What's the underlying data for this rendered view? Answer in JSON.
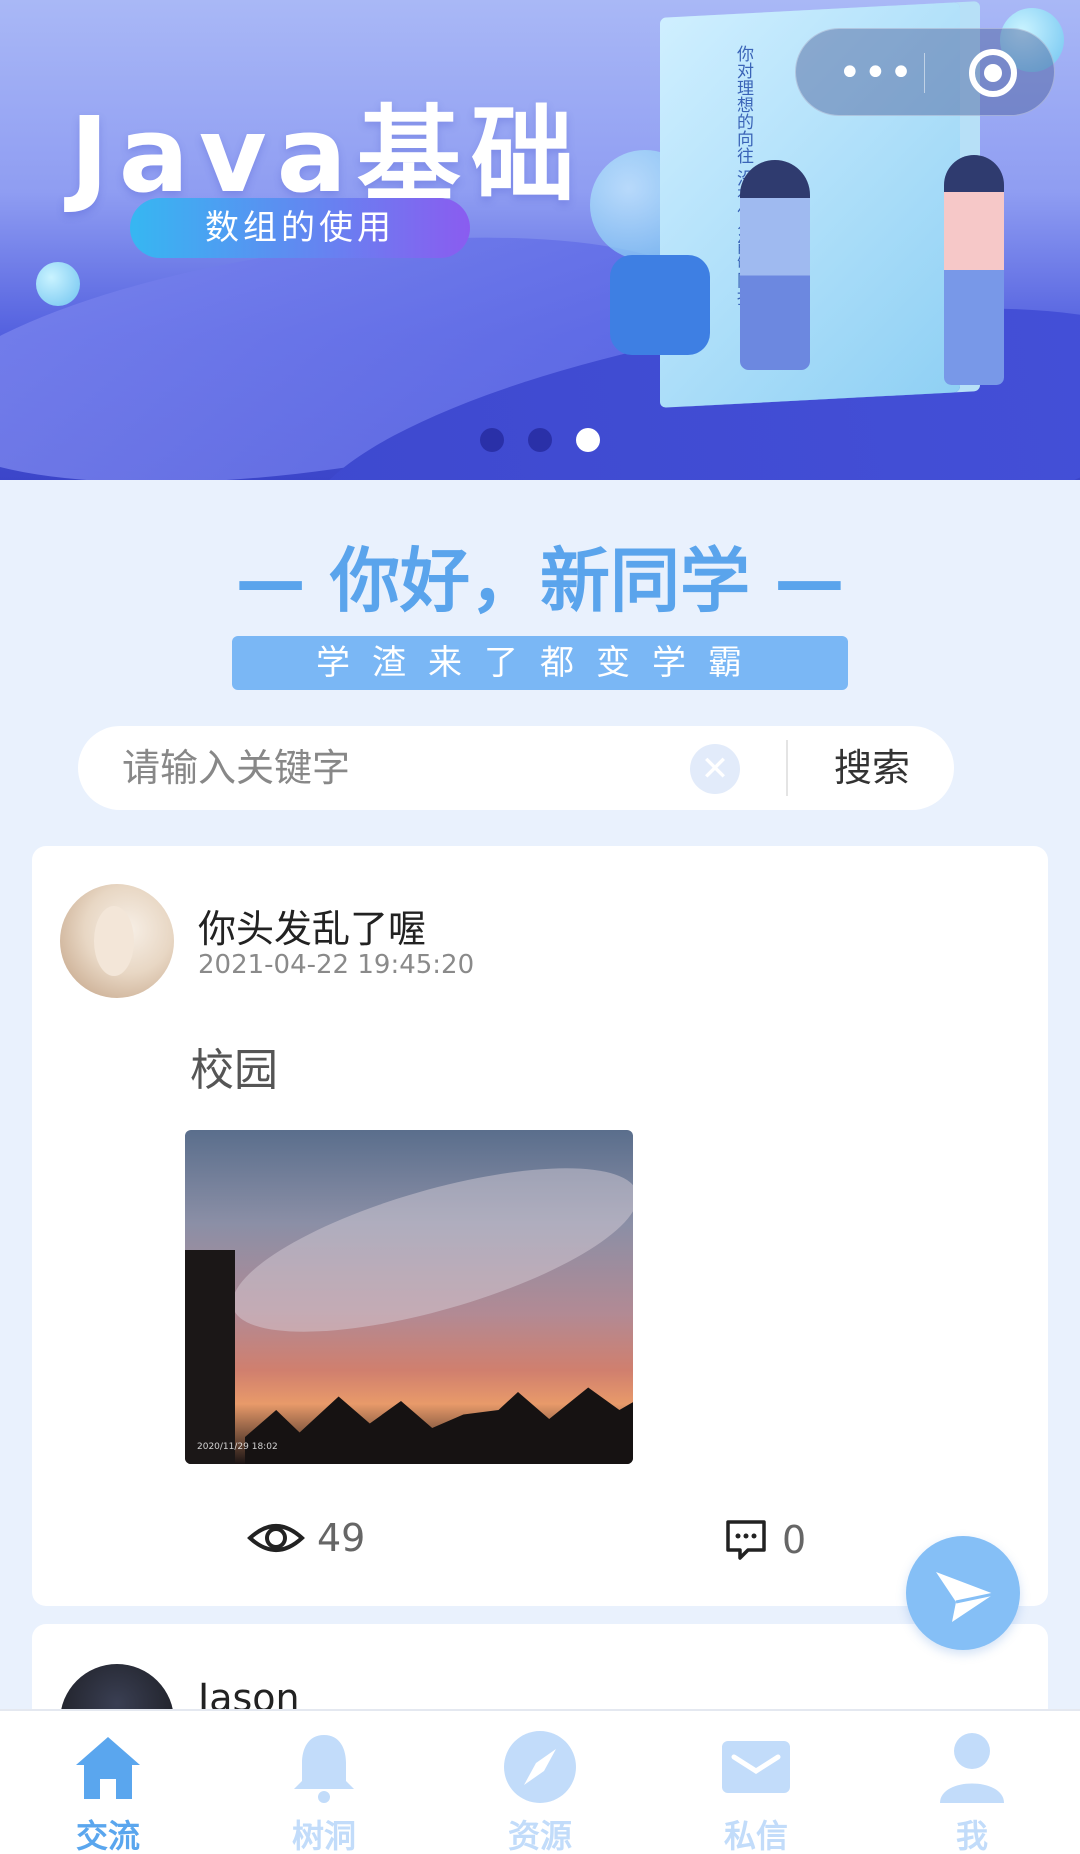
{
  "banner": {
    "title": "Java基础",
    "subtitle": "数组的使用",
    "book_text": "你对理想的向往 没有什么能够阻挡",
    "indicator_count": 3,
    "active_indicator": 3
  },
  "capsule": {
    "more_icon": "more-dots-icon",
    "close_icon": "target-icon"
  },
  "greeting": "— 你好，新同学 —",
  "slogan": "学渣来了都变学霸",
  "search": {
    "placeholder": "请输入关键字",
    "button_label": "搜索",
    "clear_icon": "clear-icon"
  },
  "post": {
    "username": "你头发乱了喔",
    "time": "2021-04-22 19:45:20",
    "text": "校园",
    "image_stamp": "2020/11/29 18:02",
    "views": "49",
    "comments": "0"
  },
  "post2": {
    "username": "Jason"
  },
  "colors": {
    "accent": "#5aa6ee",
    "accent_light": "#c2dcfa",
    "background": "#e9f1fd"
  },
  "tabs": [
    {
      "label": "交流",
      "icon": "home-icon",
      "active": true
    },
    {
      "label": "树洞",
      "icon": "bell-icon",
      "active": false
    },
    {
      "label": "资源",
      "icon": "compass-icon",
      "active": false
    },
    {
      "label": "私信",
      "icon": "mail-icon",
      "active": false
    },
    {
      "label": "我",
      "icon": "user-icon",
      "active": false
    }
  ]
}
